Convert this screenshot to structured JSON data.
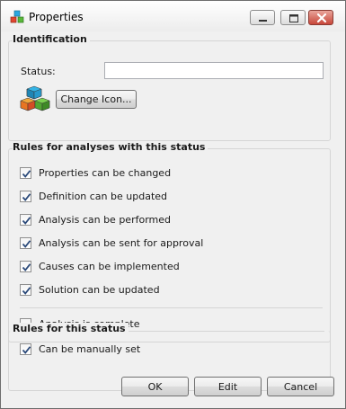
{
  "window": {
    "title": "Properties",
    "app_icon": "cubes-icon",
    "controls": {
      "minimize": "minimize-icon",
      "maximize": "maximize-icon",
      "close": "close-icon"
    }
  },
  "identification": {
    "title": "Identification",
    "status_label": "Status:",
    "status_value": "",
    "status_placeholder": "",
    "icon": "colored-cubes-icon",
    "change_icon_label": "Change Icon..."
  },
  "rules_analyses": {
    "title": "Rules for analyses with this status",
    "items": [
      {
        "label": "Properties can be changed",
        "checked": true
      },
      {
        "label": "Definition can be updated",
        "checked": true
      },
      {
        "label": "Analysis can be performed",
        "checked": true
      },
      {
        "label": "Analysis can be sent for approval",
        "checked": true
      },
      {
        "label": "Causes can be implemented",
        "checked": true
      },
      {
        "label": "Solution can be updated",
        "checked": true
      }
    ],
    "complete": {
      "label": "Analysis is complete",
      "checked": false
    }
  },
  "rules_status": {
    "title": "Rules for this status",
    "manual": {
      "label": "Can be manually set",
      "checked": true
    }
  },
  "footer": {
    "ok_label": "OK",
    "edit_label": "Edit",
    "cancel_label": "Cancel"
  },
  "colors": {
    "check": "#2b4a7a",
    "close_button": "#c8473a"
  }
}
